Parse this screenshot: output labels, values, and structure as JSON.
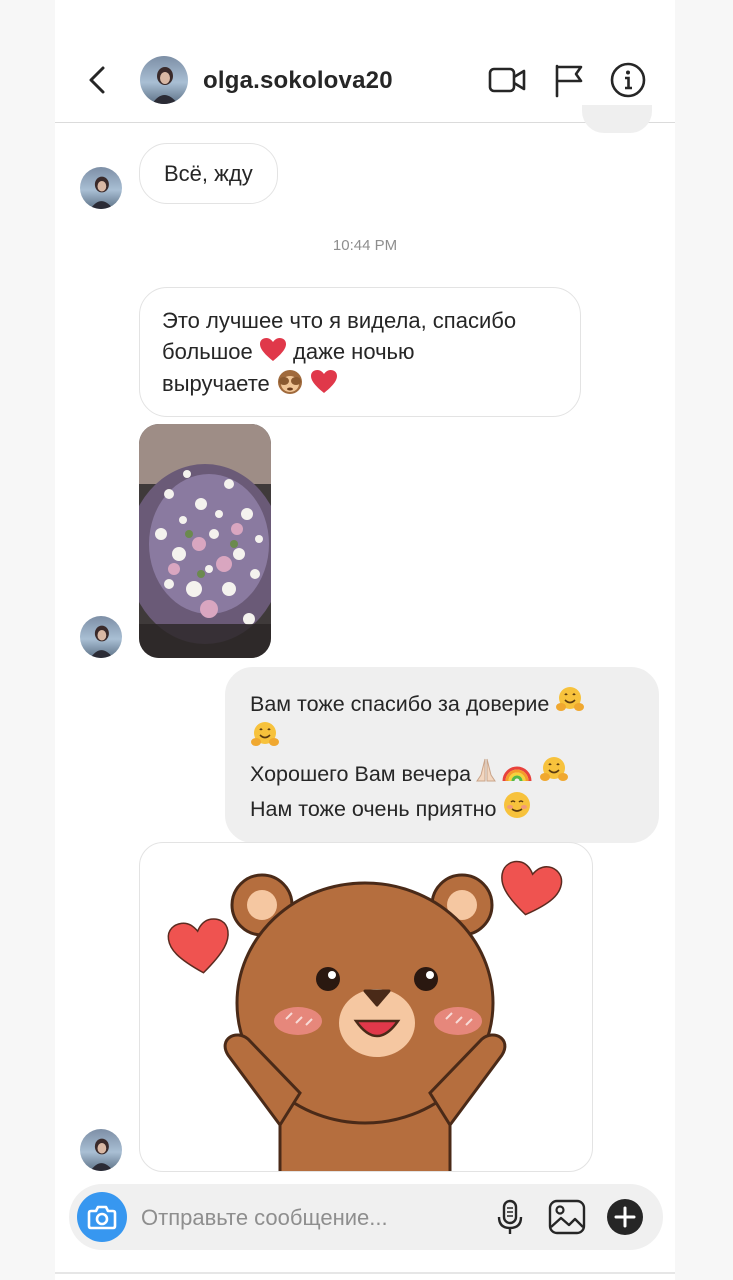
{
  "header": {
    "username": "olga.sokolova20",
    "back_icon": "chevron-left-icon",
    "video_icon": "video-camera-icon",
    "flag_icon": "flag-icon",
    "info_icon": "info-icon"
  },
  "messages": {
    "received_1": "Всё, жду",
    "timestamp": "10:44 PM",
    "received_2_line1": "Это лучшее что я видела, спасибо",
    "received_2_line2_a": "большое",
    "received_2_line2_b": "даже ночью",
    "received_2_line3": "выручаете",
    "sent_line1": "Вам тоже спасибо за доверие",
    "sent_line2": "Хорошего Вам вечера",
    "sent_line3": "Нам тоже очень приятно"
  },
  "composer": {
    "placeholder": "Отправьте сообщение...",
    "camera_icon": "camera-icon",
    "mic_icon": "microphone-icon",
    "gallery_icon": "gallery-icon",
    "plus_icon": "plus-icon"
  },
  "colors": {
    "accent": "#3797f0",
    "heart": "#e0384a",
    "bubble_mine": "#efefef"
  }
}
